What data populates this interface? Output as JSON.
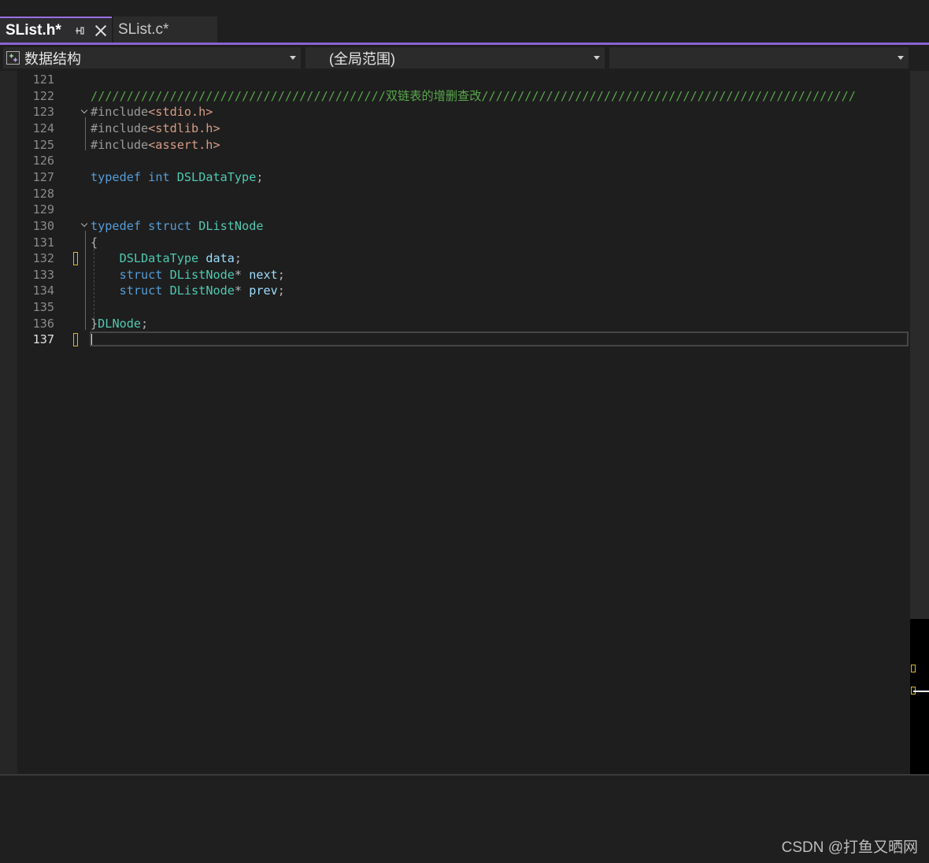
{
  "tabs": [
    {
      "title": "SList.h*",
      "active": true,
      "pin_glyph": "⊣",
      "close_glyph": "×"
    },
    {
      "title": "SList.c*",
      "active": false
    }
  ],
  "navbar": {
    "project": "数据结构",
    "scope": "(全局范围)",
    "member": ""
  },
  "editor": {
    "current_line": 137,
    "lines": [
      {
        "n": "121",
        "html": ""
      },
      {
        "n": "122",
        "html": "<span class=\"c-com\">/////////////////////////////////////////双链表的增删查改////////////////////////////////////////////////////</span>"
      },
      {
        "n": "123",
        "html": "<span class=\"c-pp\">#include</span><span class=\"c-str\">&lt;stdio.h&gt;</span>"
      },
      {
        "n": "124",
        "html": "<span class=\"c-pp\">#include</span><span class=\"c-str\">&lt;stdlib.h&gt;</span>"
      },
      {
        "n": "125",
        "html": "<span class=\"c-pp\">#include</span><span class=\"c-str\">&lt;assert.h&gt;</span>"
      },
      {
        "n": "126",
        "html": ""
      },
      {
        "n": "127",
        "html": "<span class=\"c-kw\">typedef</span> <span class=\"c-kw\">int</span> <span class=\"c-type\">DSLDataType</span><span class=\"c-pun\">;</span>"
      },
      {
        "n": "128",
        "html": ""
      },
      {
        "n": "129",
        "html": ""
      },
      {
        "n": "130",
        "html": "<span class=\"c-kw\">typedef</span> <span class=\"c-kw\">struct</span> <span class=\"c-type\">DListNode</span>"
      },
      {
        "n": "131",
        "html": "<span class=\"c-pun\">{</span>"
      },
      {
        "n": "132",
        "html": "    <span class=\"c-type\">DSLDataType</span> <span class=\"c-var\">data</span><span class=\"c-pun\">;</span>"
      },
      {
        "n": "133",
        "html": "    <span class=\"c-kw\">struct</span> <span class=\"c-type\">DListNode</span><span class=\"c-pun\">*</span> <span class=\"c-var\">next</span><span class=\"c-pun\">;</span>"
      },
      {
        "n": "134",
        "html": "    <span class=\"c-kw\">struct</span> <span class=\"c-type\">DListNode</span><span class=\"c-pun\">*</span> <span class=\"c-var\">prev</span><span class=\"c-pun\">;</span>"
      },
      {
        "n": "135",
        "html": ""
      },
      {
        "n": "136",
        "html": "<span class=\"c-pun\">}</span><span class=\"c-type\">DLNode</span><span class=\"c-pun\">;</span>"
      },
      {
        "n": "137",
        "html": ""
      }
    ]
  },
  "watermark": "CSDN @打鱼又晒网",
  "colors": {
    "accent": "#8a63d2",
    "comment": "#57a64a",
    "keyword": "#569cd6",
    "type": "#4ec9b0",
    "string": "#d69d85",
    "change_marker": "#d7ba2f"
  }
}
